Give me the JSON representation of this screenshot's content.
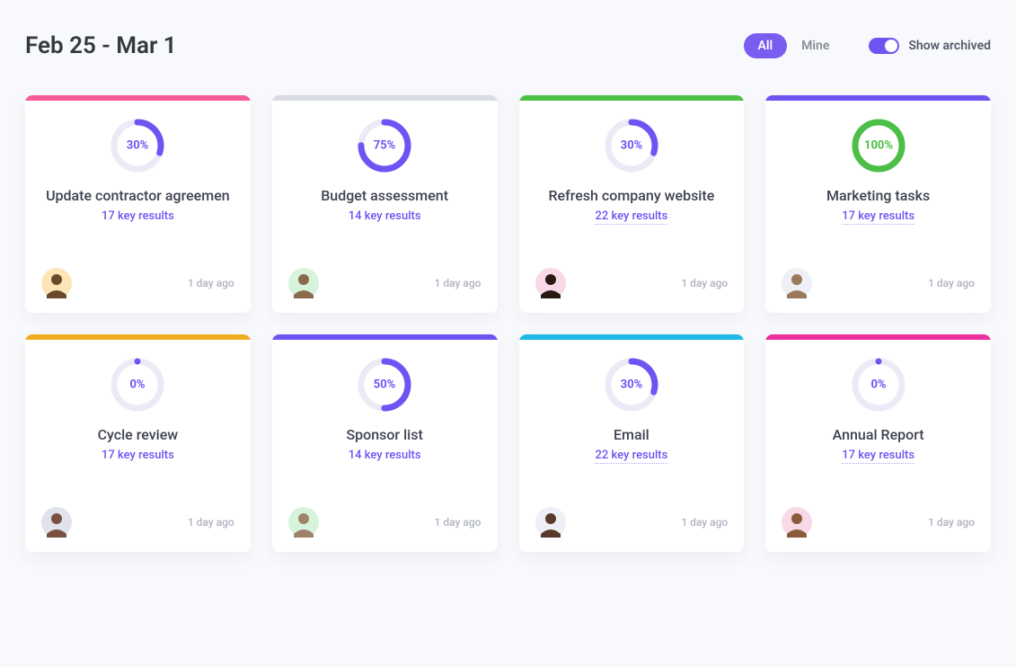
{
  "header": {
    "date_range": "Feb 25 - Mar 1",
    "filter_all": "All",
    "filter_mine": "Mine",
    "toggle_label": "Show archived"
  },
  "colors": {
    "accent": "#6f53f3"
  },
  "cards": [
    {
      "stripe": "#f85b99",
      "percent": 30,
      "percent_label": "30%",
      "ring_color": "#6f53f3",
      "title": "Update contractor agreemen",
      "sub": "17 key results",
      "link_style": "solid",
      "avatar_bg": "#fce6b8",
      "avatar_fg": "#6a4a2a",
      "timestamp": "1 day ago"
    },
    {
      "stripe": "#d9dbe3",
      "percent": 75,
      "percent_label": "75%",
      "ring_color": "#6f53f3",
      "title": "Budget assessment",
      "sub": "14 key results",
      "link_style": "solid",
      "avatar_bg": "#d8f3dc",
      "avatar_fg": "#8a6a4a",
      "timestamp": "1 day ago"
    },
    {
      "stripe": "#4bbf46",
      "percent": 30,
      "percent_label": "30%",
      "ring_color": "#6f53f3",
      "title": "Refresh company website",
      "sub": "22 key results",
      "link_style": "linky",
      "avatar_bg": "#f9d9e8",
      "avatar_fg": "#2a1a12",
      "timestamp": "1 day ago"
    },
    {
      "stripe": "#6f53f3",
      "percent": 100,
      "percent_label": "100%",
      "ring_color": "#4bbf46",
      "title": "Marketing tasks",
      "sub": "17 key results",
      "link_style": "linky",
      "avatar_bg": "#eef0f5",
      "avatar_fg": "#9a7a5a",
      "timestamp": "1 day ago"
    },
    {
      "stripe": "#f0ac1f",
      "percent": 0,
      "percent_label": "0%",
      "ring_color": "#6f53f3",
      "title": "Cycle review",
      "sub": "17 key results",
      "link_style": "solid",
      "avatar_bg": "#e0e3eb",
      "avatar_fg": "#7a5040",
      "timestamp": "1 day ago"
    },
    {
      "stripe": "#6f53f3",
      "percent": 50,
      "percent_label": "50%",
      "ring_color": "#6f53f3",
      "title": "Sponsor list",
      "sub": "14 key results",
      "link_style": "solid",
      "avatar_bg": "#d8f3dc",
      "avatar_fg": "#a0826a",
      "timestamp": "1 day ago"
    },
    {
      "stripe": "#1fb9e6",
      "percent": 30,
      "percent_label": "30%",
      "ring_color": "#6f53f3",
      "title": "Email",
      "sub": "22 key results",
      "link_style": "linky",
      "avatar_bg": "#eef0f5",
      "avatar_fg": "#5a3a2a",
      "timestamp": "1 day ago"
    },
    {
      "stripe": "#ee2f9d",
      "percent": 0,
      "percent_label": "0%",
      "ring_color": "#6f53f3",
      "title": "Annual Report",
      "sub": "17 key results",
      "link_style": "linky",
      "avatar_bg": "#f9d9e8",
      "avatar_fg": "#8a5a3a",
      "timestamp": "1 day ago"
    }
  ]
}
